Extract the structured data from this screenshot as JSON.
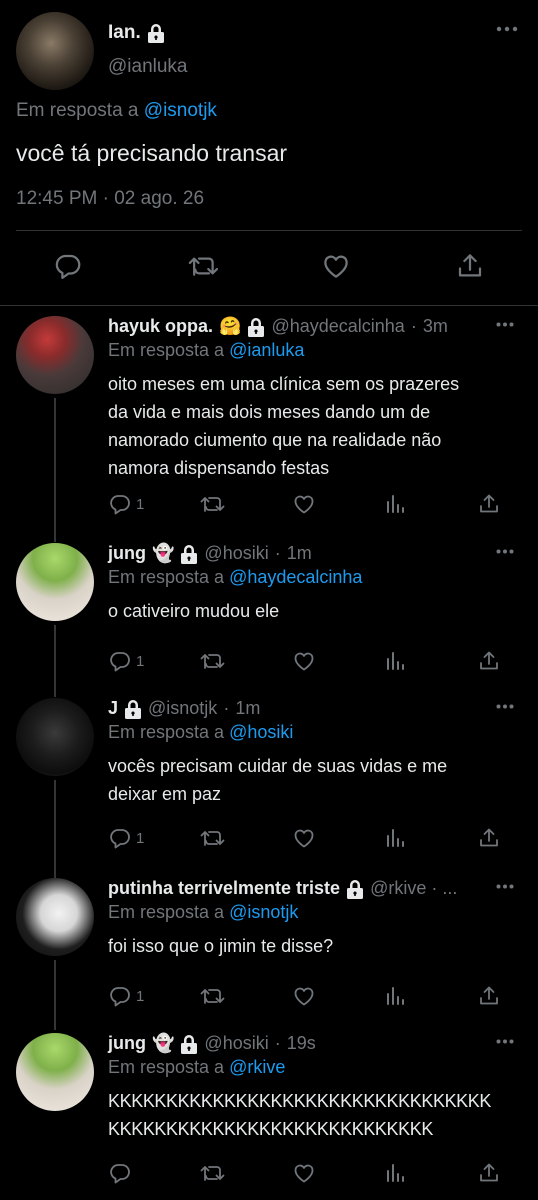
{
  "main_tweet": {
    "name": "Ian.",
    "handle": "@ianluka",
    "reply_prefix": "Em resposta a",
    "reply_to": "@isnotjk",
    "text": "você tá precisando transar",
    "time": "12:45 PM",
    "separator": "·",
    "date": "02 ago. 26"
  },
  "replies": [
    {
      "name": "hayuk oppa.",
      "emoji": "🤗",
      "handle": "@haydecalcinha",
      "age": "3m",
      "reply_prefix": "Em resposta a",
      "reply_to": "@ianluka",
      "lines": [
        "oito meses em uma clínica sem os prazeres",
        "da vida e mais dois meses dando um de",
        "namorado ciumento que na realidade não",
        "namora dispensando festas"
      ],
      "reply_count": "1"
    },
    {
      "name": "jung",
      "emoji": "👻",
      "handle": "@hosiki",
      "age": "1m",
      "reply_prefix": "Em resposta a",
      "reply_to": "@haydecalcinha",
      "lines": [
        "o cativeiro mudou ele"
      ],
      "reply_count": "1"
    },
    {
      "name": "J",
      "emoji": "",
      "handle": "@isnotjk",
      "age": "1m",
      "reply_prefix": "Em resposta a",
      "reply_to": "@hosiki",
      "lines": [
        "vocês precisam cuidar de suas vidas e me",
        "deixar em paz"
      ],
      "reply_count": "1"
    },
    {
      "name": "putinha terrivelmente triste",
      "emoji": "",
      "handle": "@rkive · ...",
      "age": "",
      "reply_prefix": "Em resposta a",
      "reply_to": "@isnotjk",
      "lines": [
        "foi isso que o jimin te disse?"
      ],
      "reply_count": "1"
    },
    {
      "name": "jung",
      "emoji": "👻",
      "handle": "@hosiki",
      "age": "19s",
      "reply_prefix": "Em resposta a",
      "reply_to": "@rkive",
      "lines": [
        "KKKKKKKKKKKKKKKKKKKKKKKKKKKKKKKKK",
        "KKKKKKKKKKKKKKKKKKKKKKKKKKKK"
      ],
      "reply_count": ""
    }
  ],
  "icons": {
    "reply": "reply-icon",
    "retweet": "retweet-icon",
    "like": "heart-icon",
    "views": "analytics-icon",
    "share": "share-icon",
    "more": "more-icon",
    "lock": "lock-icon"
  },
  "colors": {
    "background": "#000000",
    "text": "#e7e9ea",
    "muted": "#71767b",
    "link": "#1d9bf0",
    "divider": "#2f3336"
  }
}
